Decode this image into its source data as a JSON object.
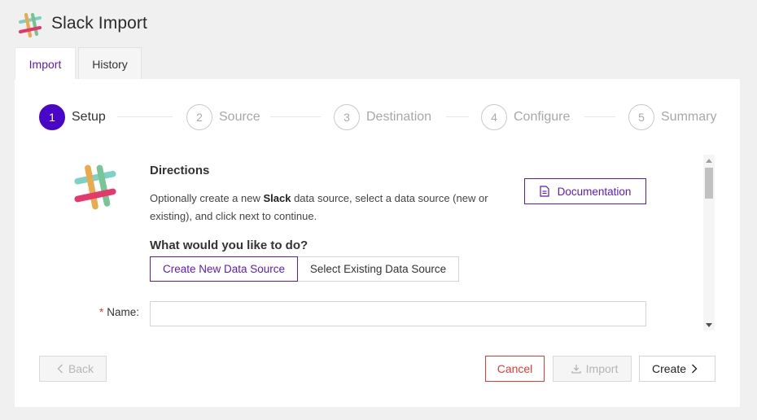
{
  "app": {
    "title": "Slack Import",
    "logo_icon": "slack-logo"
  },
  "tabs": [
    {
      "label": "Import",
      "active": true
    },
    {
      "label": "History",
      "active": false
    }
  ],
  "steps": [
    {
      "number": "1",
      "label": "Setup",
      "active": true
    },
    {
      "number": "2",
      "label": "Source",
      "active": false
    },
    {
      "number": "3",
      "label": "Destination",
      "active": false
    },
    {
      "number": "4",
      "label": "Configure",
      "active": false
    },
    {
      "number": "5",
      "label": "Summary",
      "active": false
    }
  ],
  "directions": {
    "title": "Directions",
    "text_before": "Optionally create a new ",
    "text_bold": "Slack",
    "text_after": " data source, select a data source (new or existing), and click next to continue.",
    "doc_button": "Documentation"
  },
  "question": "What would you like to do?",
  "choices": {
    "create_new": "Create New Data Source",
    "select_existing": "Select Existing Data Source",
    "selected": "create_new"
  },
  "form": {
    "name_label": "Name",
    "name_required_mark": "*",
    "name_value": "",
    "name_placeholder": ""
  },
  "footer": {
    "back": "Back",
    "cancel": "Cancel",
    "import": "Import",
    "create": "Create"
  },
  "colors": {
    "accent": "#4a06c8",
    "accent_text": "#5b19c4",
    "danger": "#e53935",
    "disabled_text": "#b5b5b5"
  }
}
